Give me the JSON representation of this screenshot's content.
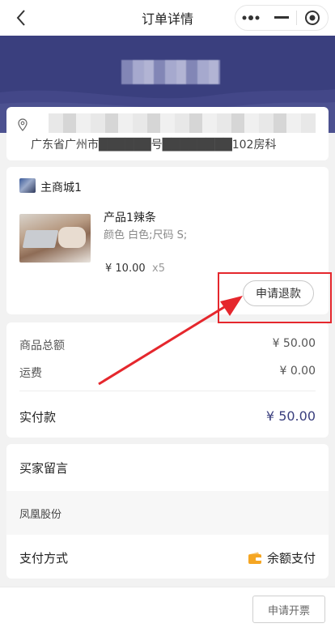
{
  "nav": {
    "title": "订单详情",
    "back_icon": "chevron-left-icon"
  },
  "address": {
    "line": "广东省广州市██████号████████102房科"
  },
  "shop": {
    "name": "主商城1"
  },
  "product": {
    "name": "产品1辣条",
    "spec": "颜色 白色;尺码 S;",
    "price": "¥ 10.00",
    "qty": "x5"
  },
  "actions": {
    "refund_label": "申请退款",
    "invoice_label": "申请开票"
  },
  "summary": {
    "goods_label": "商品总额",
    "goods_value": "¥ 50.00",
    "shipping_label": "运费",
    "shipping_value": "¥ 0.00",
    "paid_label": "实付款",
    "paid_value": "¥ 50.00"
  },
  "info": {
    "buyer_message_label": "买家留言",
    "buyer_message": "凤凰股份",
    "payment_label": "支付方式",
    "payment_value": "余额支付"
  },
  "colors": {
    "theme": "#3a3f7e",
    "annotation": "#e5272d",
    "wallet": "#f5a623"
  }
}
